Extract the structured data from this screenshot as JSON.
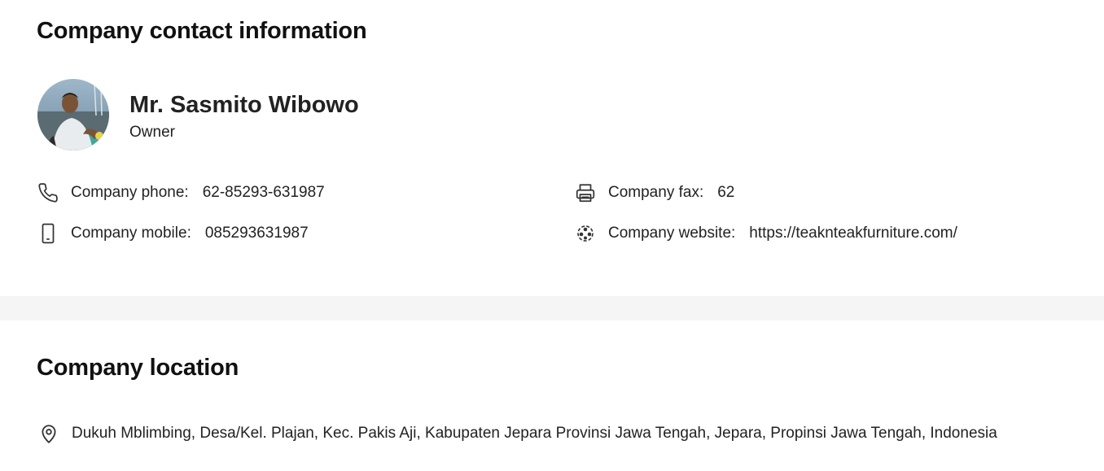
{
  "contact": {
    "heading": "Company contact information",
    "person": {
      "name": "Mr. Sasmito Wibowo",
      "role": "Owner"
    },
    "phone": {
      "label": "Company phone:",
      "value": "62-85293-631987",
      "icon": "phone-icon"
    },
    "mobile": {
      "label": "Company mobile:",
      "value": "085293631987",
      "icon": "mobile-icon"
    },
    "fax": {
      "label": "Company fax:",
      "value": "62",
      "icon": "printer-icon"
    },
    "website": {
      "label": "Company website:",
      "value": "https://teaknteakfurniture.com/",
      "icon": "globe-icon"
    }
  },
  "location": {
    "heading": "Company location",
    "address": "Dukuh Mblimbing, Desa/Kel. Plajan, Kec. Pakis Aji, Kabupaten Jepara Provinsi Jawa Tengah, Jepara, Propinsi Jawa Tengah, Indonesia",
    "icon": "map-pin-icon"
  },
  "colors": {
    "text": "#222222",
    "heading": "#111111",
    "band": "#f5f5f5"
  }
}
